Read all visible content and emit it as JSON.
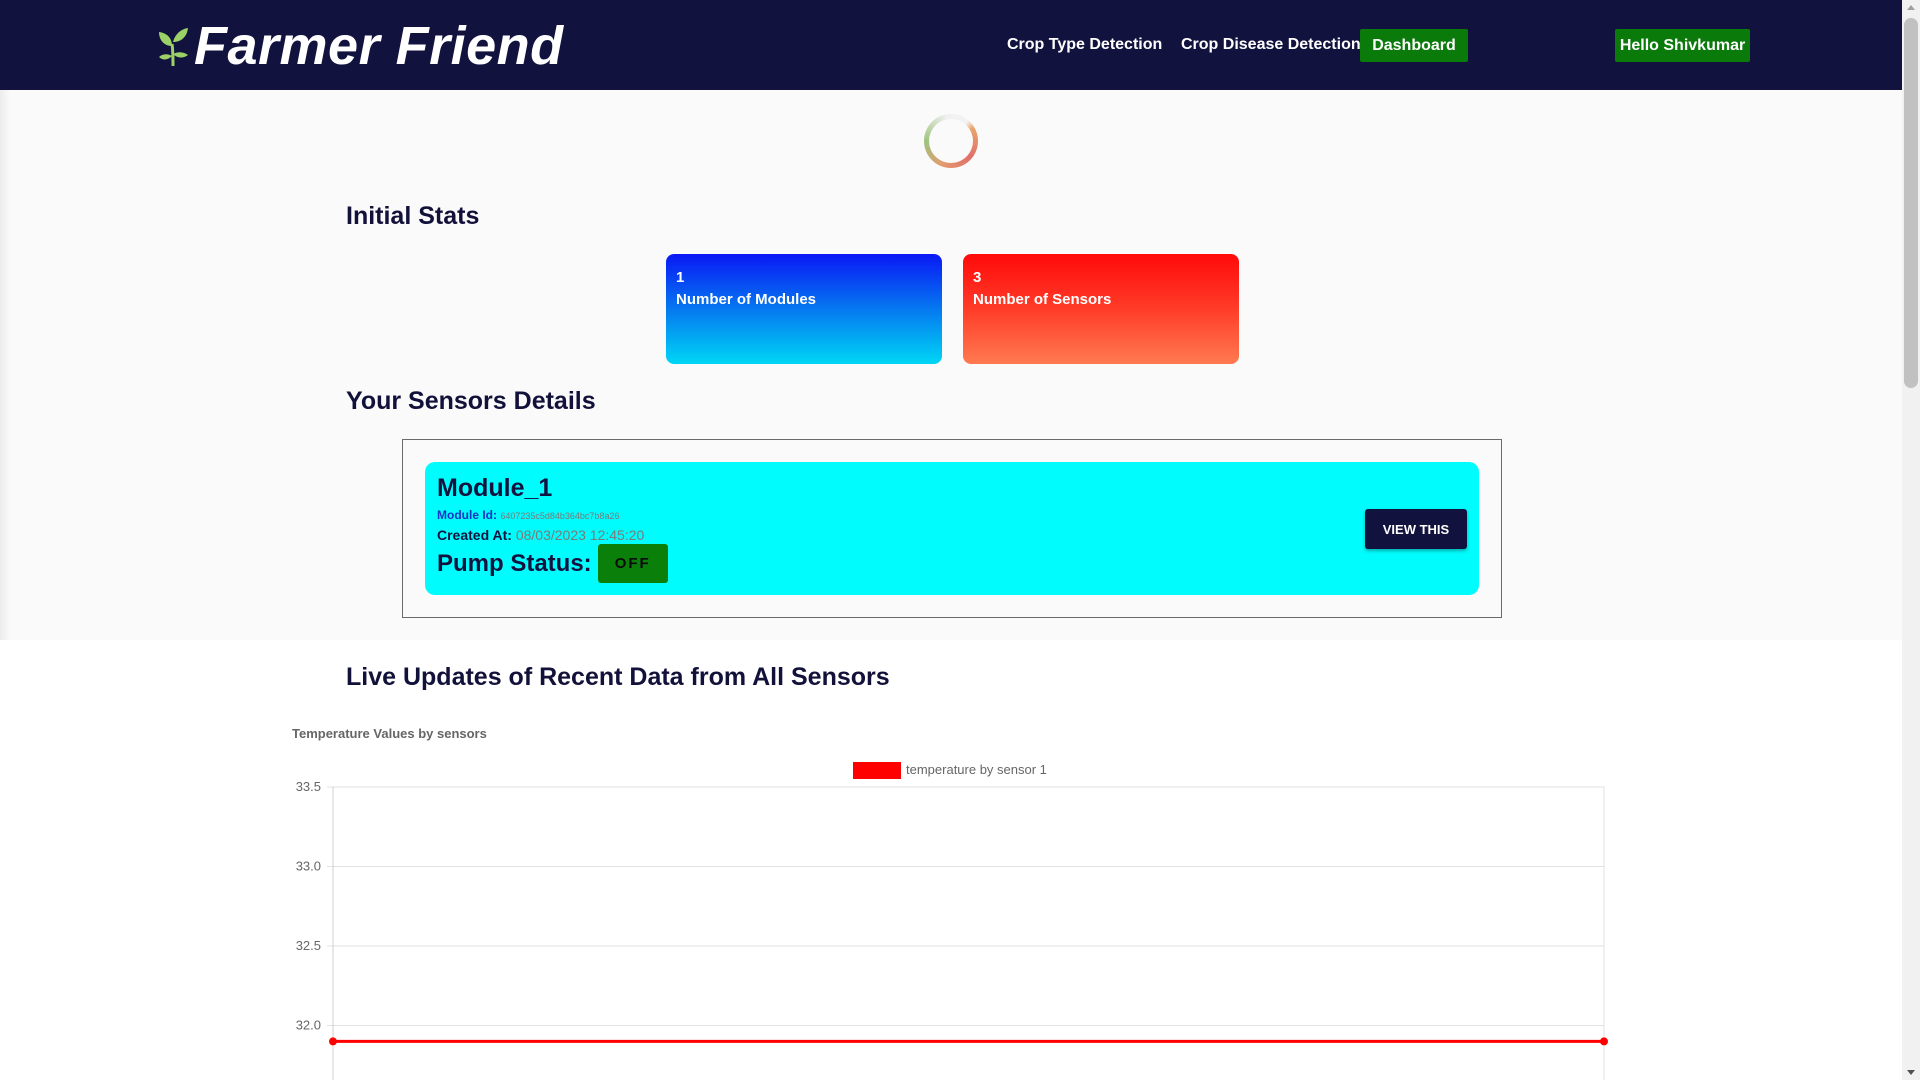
{
  "navbar": {
    "brand": "Farmer Friend",
    "links": [
      "Crop Type Detection",
      "Crop Disease Detection"
    ],
    "active_button": "Dashboard",
    "user_button": "Hello Shivkumar"
  },
  "sections": {
    "initial_stats": "Initial Stats",
    "sensor_details": "Your Sensors Details",
    "live_updates": "Live Updates of Recent Data from All Sensors"
  },
  "stats": [
    {
      "value": "1",
      "label": "Number of Modules",
      "color": "#0a18f5"
    },
    {
      "value": "3",
      "label": "Number of Sensors",
      "color": "#ff0a0a"
    }
  ],
  "module": {
    "name": "Module_1",
    "id_label": "Module Id:",
    "id_value": "6407235c5d84b364bc7b8a26",
    "created_label": "Created At:",
    "created_value": "08/03/2023 12:45:20",
    "pump_label": "Pump Status:",
    "pump_value": "OFF",
    "view_button": "VIEW THIS",
    "card_color": "#00fcfc"
  },
  "chart_data": {
    "type": "line",
    "title": "Temperature Values by sensors",
    "series": [
      {
        "name": "temperature by sensor 1",
        "color": "#ff0000",
        "values": [
          31.9,
          31.9
        ]
      }
    ],
    "ytick_labels": [
      "33.5",
      "33.0",
      "32.5",
      "32.0"
    ],
    "ylim": [
      31.9,
      33.5
    ],
    "grid": true,
    "legend": "top-center"
  }
}
